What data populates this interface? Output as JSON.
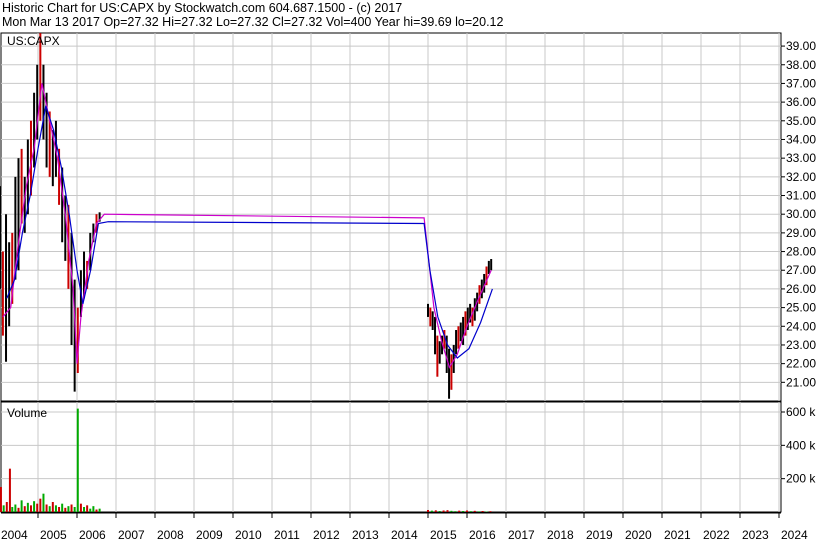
{
  "header": {
    "line1": "Historic Chart for US:CAPX by Stockwatch.com 604.687.1500 - (c) 2017",
    "line2": "Mon Mar 13 2017   Op=27.32  Hi=27.32  Lo=27.32  Cl=27.32  Vol=400   Year hi=39.69  lo=20.12"
  },
  "colors": {
    "background": "#ffffff",
    "grid": "#c8c8c8",
    "border": "#000000",
    "price_bar": "#000000",
    "price_bar_down": "#cc0000",
    "ma_fast": "#cc00cc",
    "ma_slow": "#0000cc",
    "volume_up": "#00aa00",
    "volume_down": "#cc0000"
  },
  "chart_data": [
    {
      "type": "line",
      "title": "US:CAPX",
      "xlabel": "",
      "ylabel": "",
      "grid": true,
      "x_ticks": [
        "2004",
        "2005",
        "2006",
        "2007",
        "2008",
        "2009",
        "2010",
        "2011",
        "2012",
        "2013",
        "2014",
        "2015",
        "2016",
        "2017",
        "2018",
        "2019",
        "2020",
        "2021",
        "2022",
        "2023",
        "2024"
      ],
      "ylim": [
        20.0,
        39.7
      ],
      "y_ticks": [
        "39.00",
        "38.00",
        "37.00",
        "36.00",
        "35.00",
        "34.00",
        "33.00",
        "32.00",
        "31.00",
        "30.00",
        "29.00",
        "28.00",
        "27.00",
        "26.00",
        "25.00",
        "24.00",
        "23.00",
        "22.00",
        "21.00"
      ],
      "price_range_bars": [
        {
          "x": 2004.02,
          "high": 31.5,
          "low": 26.0
        },
        {
          "x": 2004.1,
          "high": 28.0,
          "low": 23.5
        },
        {
          "x": 2004.18,
          "high": 30.0,
          "low": 22.1
        },
        {
          "x": 2004.26,
          "high": 28.5,
          "low": 24.0
        },
        {
          "x": 2004.34,
          "high": 29.0,
          "low": 25.2
        },
        {
          "x": 2004.42,
          "high": 32.0,
          "low": 26.5
        },
        {
          "x": 2004.5,
          "high": 33.0,
          "low": 27.0
        },
        {
          "x": 2004.58,
          "high": 33.5,
          "low": 29.5
        },
        {
          "x": 2004.66,
          "high": 32.0,
          "low": 29.0
        },
        {
          "x": 2004.74,
          "high": 34.0,
          "low": 30.0
        },
        {
          "x": 2004.82,
          "high": 35.0,
          "low": 31.0
        },
        {
          "x": 2004.9,
          "high": 36.5,
          "low": 32.5
        },
        {
          "x": 2004.98,
          "high": 38.0,
          "low": 34.0
        },
        {
          "x": 2005.06,
          "high": 39.69,
          "low": 35.0
        },
        {
          "x": 2005.14,
          "high": 38.0,
          "low": 34.0
        },
        {
          "x": 2005.22,
          "high": 36.5,
          "low": 32.5
        },
        {
          "x": 2005.3,
          "high": 35.5,
          "low": 32.0
        },
        {
          "x": 2005.38,
          "high": 34.5,
          "low": 31.5
        },
        {
          "x": 2005.46,
          "high": 35.0,
          "low": 32.0
        },
        {
          "x": 2005.54,
          "high": 33.5,
          "low": 30.5
        },
        {
          "x": 2005.62,
          "high": 32.5,
          "low": 28.5
        },
        {
          "x": 2005.7,
          "high": 31.0,
          "low": 27.5
        },
        {
          "x": 2005.78,
          "high": 30.5,
          "low": 26.0
        },
        {
          "x": 2005.86,
          "high": 29.0,
          "low": 23.0
        },
        {
          "x": 2005.94,
          "high": 26.5,
          "low": 20.5
        },
        {
          "x": 2006.02,
          "high": 25.0,
          "low": 21.5
        },
        {
          "x": 2006.1,
          "high": 27.0,
          "low": 24.5
        },
        {
          "x": 2006.18,
          "high": 28.0,
          "low": 25.5
        },
        {
          "x": 2006.26,
          "high": 27.5,
          "low": 26.0
        },
        {
          "x": 2006.34,
          "high": 29.0,
          "low": 27.0
        },
        {
          "x": 2006.42,
          "high": 29.5,
          "low": 28.5
        },
        {
          "x": 2006.5,
          "high": 30.0,
          "low": 29.0
        },
        {
          "x": 2006.58,
          "high": 30.1,
          "low": 29.6
        },
        {
          "x": 2015.0,
          "high": 25.2,
          "low": 24.5
        },
        {
          "x": 2015.06,
          "high": 25.0,
          "low": 24.0
        },
        {
          "x": 2015.12,
          "high": 24.8,
          "low": 23.8
        },
        {
          "x": 2015.18,
          "high": 24.5,
          "low": 22.5
        },
        {
          "x": 2015.24,
          "high": 23.5,
          "low": 21.3
        },
        {
          "x": 2015.3,
          "high": 23.2,
          "low": 22.0
        },
        {
          "x": 2015.36,
          "high": 23.5,
          "low": 22.5
        },
        {
          "x": 2015.42,
          "high": 23.8,
          "low": 22.8
        },
        {
          "x": 2015.48,
          "high": 23.5,
          "low": 21.5
        },
        {
          "x": 2015.54,
          "high": 22.8,
          "low": 20.12
        },
        {
          "x": 2015.6,
          "high": 22.5,
          "low": 20.6
        },
        {
          "x": 2015.66,
          "high": 23.0,
          "low": 21.5
        },
        {
          "x": 2015.72,
          "high": 23.8,
          "low": 22.5
        },
        {
          "x": 2015.78,
          "high": 24.0,
          "low": 22.8
        },
        {
          "x": 2015.84,
          "high": 24.2,
          "low": 23.2
        },
        {
          "x": 2015.9,
          "high": 24.5,
          "low": 23.0
        },
        {
          "x": 2015.96,
          "high": 24.8,
          "low": 23.5
        },
        {
          "x": 2016.02,
          "high": 25.0,
          "low": 23.8
        },
        {
          "x": 2016.08,
          "high": 25.2,
          "low": 24.2
        },
        {
          "x": 2016.14,
          "high": 25.0,
          "low": 24.0
        },
        {
          "x": 2016.2,
          "high": 25.5,
          "low": 24.3
        },
        {
          "x": 2016.26,
          "high": 25.8,
          "low": 24.8
        },
        {
          "x": 2016.32,
          "high": 26.2,
          "low": 25.2
        },
        {
          "x": 2016.38,
          "high": 26.5,
          "low": 25.5
        },
        {
          "x": 2016.44,
          "high": 26.8,
          "low": 25.8
        },
        {
          "x": 2016.5,
          "high": 27.2,
          "low": 26.2
        },
        {
          "x": 2016.56,
          "high": 27.5,
          "low": 26.8
        },
        {
          "x": 2016.62,
          "high": 27.6,
          "low": 27.0
        }
      ],
      "series": [
        {
          "color": "#cc00cc",
          "points": [
            [
              2004.1,
              24.5
            ],
            [
              2004.3,
              25.0
            ],
            [
              2004.5,
              28.5
            ],
            [
              2004.7,
              31.5
            ],
            [
              2004.9,
              33.5
            ],
            [
              2005.1,
              37.0
            ],
            [
              2005.3,
              35.0
            ],
            [
              2005.5,
              33.0
            ],
            [
              2005.7,
              30.0
            ],
            [
              2005.9,
              26.0
            ],
            [
              2006.0,
              22.0
            ],
            [
              2006.1,
              24.5
            ],
            [
              2006.3,
              27.5
            ],
            [
              2006.5,
              29.5
            ],
            [
              2006.7,
              30.0
            ],
            [
              2014.9,
              29.8
            ],
            [
              2015.15,
              25.0
            ],
            [
              2015.35,
              23.2
            ],
            [
              2015.55,
              21.8
            ],
            [
              2015.75,
              22.5
            ],
            [
              2016.0,
              24.0
            ],
            [
              2016.3,
              25.5
            ],
            [
              2016.62,
              27.0
            ]
          ]
        },
        {
          "color": "#0000cc",
          "points": [
            [
              2004.2,
              25.5
            ],
            [
              2004.4,
              26.5
            ],
            [
              2004.6,
              29.0
            ],
            [
              2004.8,
              31.0
            ],
            [
              2005.0,
              33.5
            ],
            [
              2005.2,
              35.8
            ],
            [
              2005.4,
              34.5
            ],
            [
              2005.6,
              32.5
            ],
            [
              2005.8,
              30.0
            ],
            [
              2006.0,
              27.0
            ],
            [
              2006.15,
              25.2
            ],
            [
              2006.35,
              27.0
            ],
            [
              2006.55,
              29.5
            ],
            [
              2006.8,
              29.6
            ],
            [
              2014.9,
              29.5
            ],
            [
              2015.05,
              27.0
            ],
            [
              2015.25,
              24.5
            ],
            [
              2015.5,
              23.0
            ],
            [
              2015.75,
              22.3
            ],
            [
              2016.05,
              22.8
            ],
            [
              2016.35,
              24.2
            ],
            [
              2016.65,
              26.0
            ]
          ]
        }
      ]
    },
    {
      "type": "bar",
      "title": "Volume",
      "y_ticks": [
        "600 k",
        "400 k",
        "200 k"
      ],
      "ylim": [
        0,
        660000
      ],
      "volumes": [
        {
          "x": 2004.05,
          "v": 150000,
          "up": false
        },
        {
          "x": 2004.12,
          "v": 40000,
          "up": true
        },
        {
          "x": 2004.2,
          "v": 60000,
          "up": false
        },
        {
          "x": 2004.28,
          "v": 260000,
          "up": false
        },
        {
          "x": 2004.34,
          "v": 30000,
          "up": true
        },
        {
          "x": 2004.42,
          "v": 45000,
          "up": true
        },
        {
          "x": 2004.5,
          "v": 25000,
          "up": false
        },
        {
          "x": 2004.58,
          "v": 70000,
          "up": true
        },
        {
          "x": 2004.66,
          "v": 35000,
          "up": false
        },
        {
          "x": 2004.74,
          "v": 55000,
          "up": true
        },
        {
          "x": 2004.82,
          "v": 40000,
          "up": false
        },
        {
          "x": 2004.9,
          "v": 65000,
          "up": true
        },
        {
          "x": 2004.98,
          "v": 50000,
          "up": false
        },
        {
          "x": 2005.06,
          "v": 80000,
          "up": false
        },
        {
          "x": 2005.14,
          "v": 110000,
          "up": true
        },
        {
          "x": 2005.22,
          "v": 45000,
          "up": false
        },
        {
          "x": 2005.3,
          "v": 35000,
          "up": true
        },
        {
          "x": 2005.38,
          "v": 60000,
          "up": false
        },
        {
          "x": 2005.46,
          "v": 40000,
          "up": true
        },
        {
          "x": 2005.54,
          "v": 30000,
          "up": false
        },
        {
          "x": 2005.62,
          "v": 50000,
          "up": true
        },
        {
          "x": 2005.7,
          "v": 25000,
          "up": false
        },
        {
          "x": 2005.78,
          "v": 35000,
          "up": true
        },
        {
          "x": 2005.86,
          "v": 45000,
          "up": false
        },
        {
          "x": 2005.94,
          "v": 30000,
          "up": true
        },
        {
          "x": 2006.02,
          "v": 620000,
          "up": true
        },
        {
          "x": 2006.1,
          "v": 50000,
          "up": false
        },
        {
          "x": 2006.18,
          "v": 30000,
          "up": true
        },
        {
          "x": 2006.26,
          "v": 40000,
          "up": false
        },
        {
          "x": 2006.34,
          "v": 20000,
          "up": true
        },
        {
          "x": 2006.42,
          "v": 35000,
          "up": true
        },
        {
          "x": 2006.5,
          "v": 15000,
          "up": false
        },
        {
          "x": 2006.58,
          "v": 20000,
          "up": true
        },
        {
          "x": 2015.0,
          "v": 12000,
          "up": false
        },
        {
          "x": 2015.1,
          "v": 8000,
          "up": true
        },
        {
          "x": 2015.2,
          "v": 10000,
          "up": false
        },
        {
          "x": 2015.3,
          "v": 6000,
          "up": true
        },
        {
          "x": 2015.4,
          "v": 9000,
          "up": false
        },
        {
          "x": 2015.5,
          "v": 11000,
          "up": false
        },
        {
          "x": 2015.6,
          "v": 7000,
          "up": true
        },
        {
          "x": 2015.7,
          "v": 5000,
          "up": true
        },
        {
          "x": 2015.8,
          "v": 8000,
          "up": false
        },
        {
          "x": 2015.9,
          "v": 6000,
          "up": true
        },
        {
          "x": 2016.0,
          "v": 9000,
          "up": false
        },
        {
          "x": 2016.1,
          "v": 5000,
          "up": true
        },
        {
          "x": 2016.2,
          "v": 7000,
          "up": false
        },
        {
          "x": 2016.3,
          "v": 4000,
          "up": true
        },
        {
          "x": 2016.4,
          "v": 6000,
          "up": false
        },
        {
          "x": 2016.5,
          "v": 3000,
          "up": true
        },
        {
          "x": 2016.6,
          "v": 5000,
          "up": false
        }
      ]
    }
  ]
}
